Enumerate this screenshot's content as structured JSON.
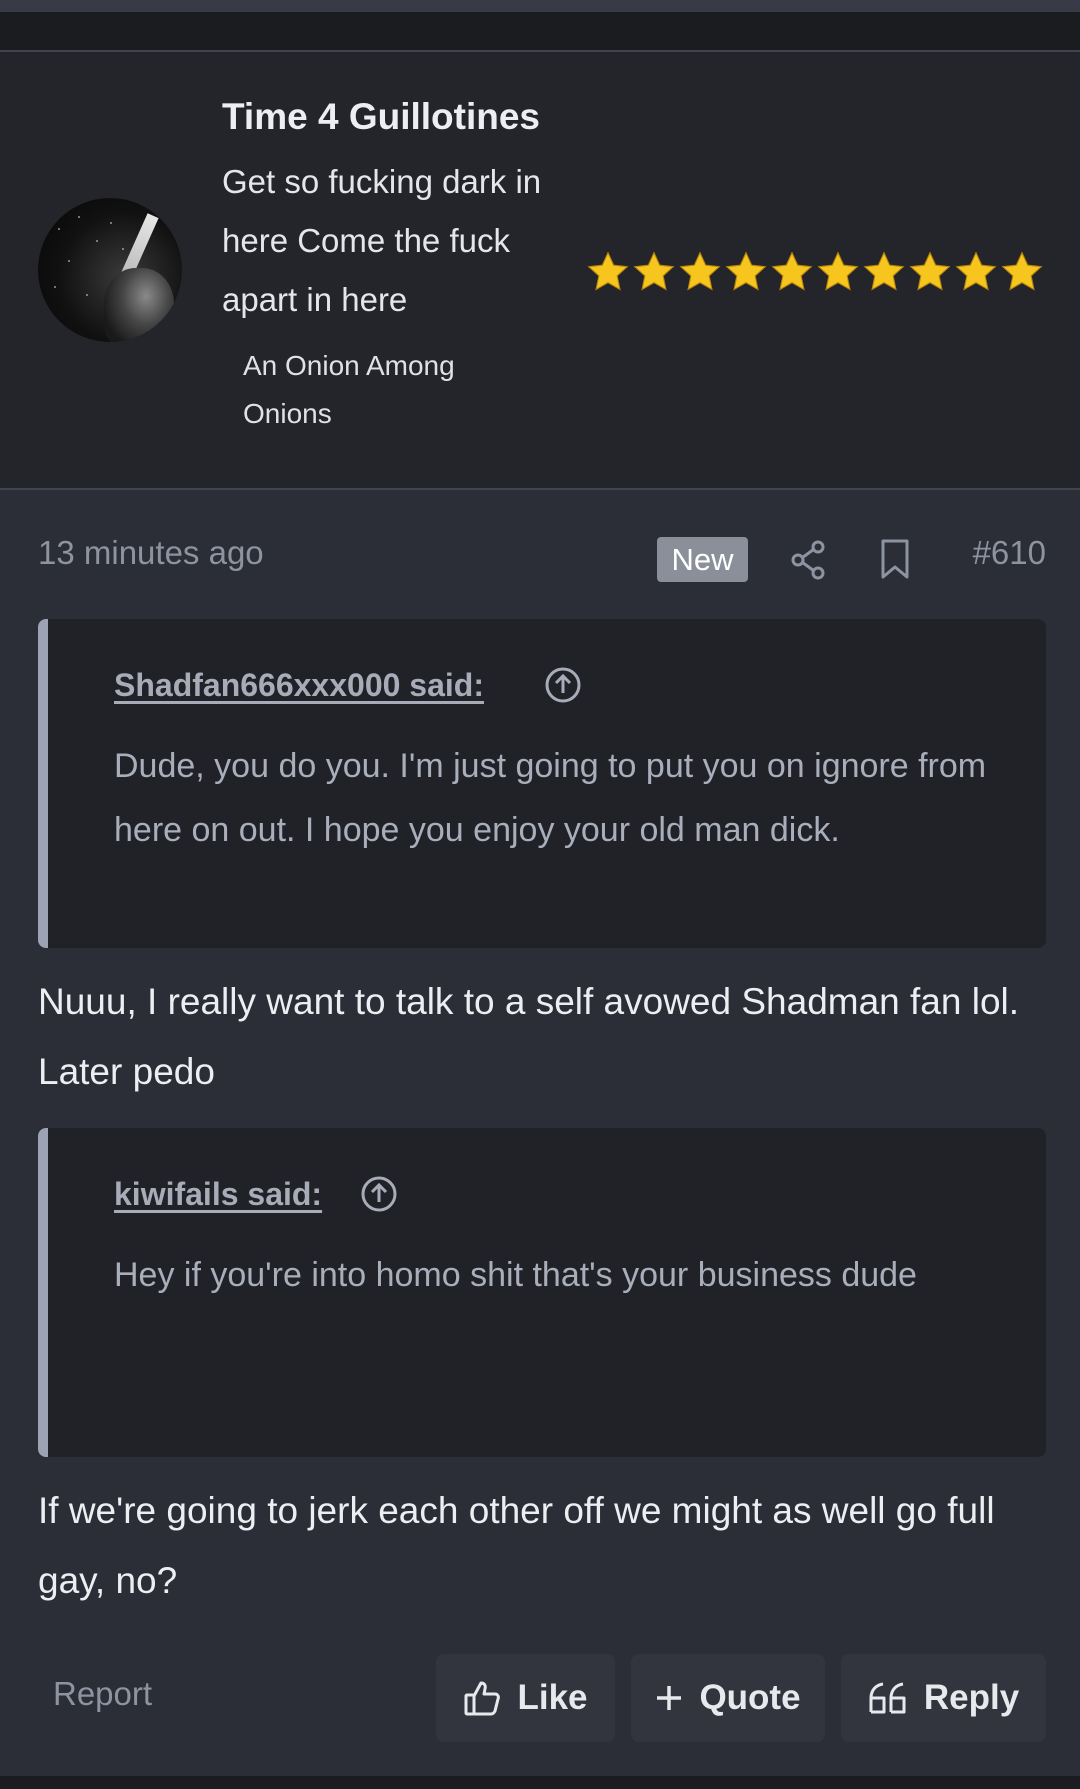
{
  "user": {
    "name": "Time 4 Guillotines",
    "title": "Get so fucking dark in here Come the fuck apart in here",
    "stars_count": 10,
    "star_color": "#f7c61e",
    "rank": "An Onion Among Onions"
  },
  "post": {
    "timestamp": "13 minutes ago",
    "badge": "New",
    "number": "#610",
    "quotes": [
      {
        "attribution": "Shadfan666xxx000 said:",
        "text": "Dude, you do you. I'm just going to put you on ignore from here on out. I hope you enjoy your old man dick."
      },
      {
        "attribution": "kiwifails said:",
        "text": "Hey if you're into homo shit that's your business dude"
      }
    ],
    "replies": [
      "Nuuu, I really want to talk to a self avowed Shadman fan lol. Later pedo",
      "If we're going to jerk each other off we might as well go full gay, no?"
    ]
  },
  "actions": {
    "report": "Report",
    "like": "Like",
    "quote": "Quote",
    "reply": "Reply"
  },
  "icons": {
    "share": "share-icon",
    "bookmark": "bookmark-icon",
    "jump": "arrow-up-circle-icon",
    "like": "thumbs-up-icon",
    "quote": "plus-icon",
    "reply": "quote-marks-icon"
  }
}
